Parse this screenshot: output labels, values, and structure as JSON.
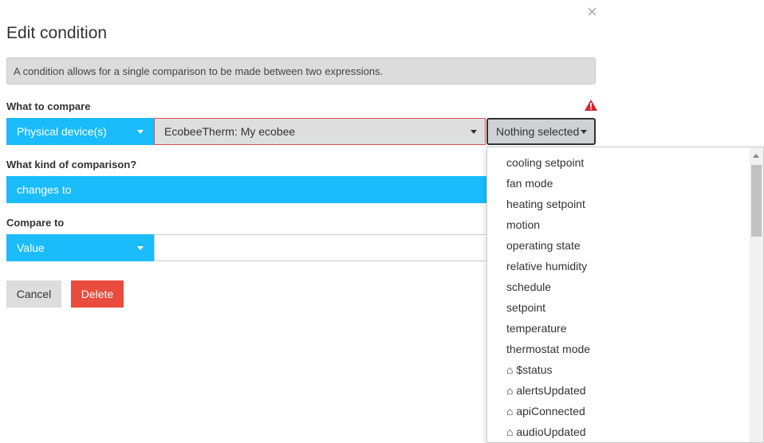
{
  "dialog": {
    "title": "Edit condition",
    "close_glyph": "×",
    "info_text": "A condition allows for a single comparison to be made between two expressions."
  },
  "what_to_compare": {
    "label": "What to compare",
    "warning_icon": "warning-triangle-icon",
    "source_type": "Physical device(s)",
    "device": "EcobeeTherm: My ecobee",
    "attribute": "Nothing selected"
  },
  "comparison": {
    "label": "What kind of comparison?",
    "operator": "changes to"
  },
  "compare_to": {
    "label": "Compare to",
    "type": "Value",
    "value": ""
  },
  "buttons": {
    "cancel": "Cancel",
    "delete": "Delete"
  },
  "attribute_options": [
    "cooling setpoint",
    "fan mode",
    "heating setpoint",
    "motion",
    "operating state",
    "relative humidity",
    "schedule",
    "setpoint",
    "temperature",
    "thermostat mode",
    "⌂ $status",
    "⌂ alertsUpdated",
    "⌂ apiConnected",
    "⌂ audioUpdated"
  ],
  "colors": {
    "accent_blue": "#1abcfc",
    "danger_red": "#e84c3d",
    "warning_red": "#d9232d"
  }
}
